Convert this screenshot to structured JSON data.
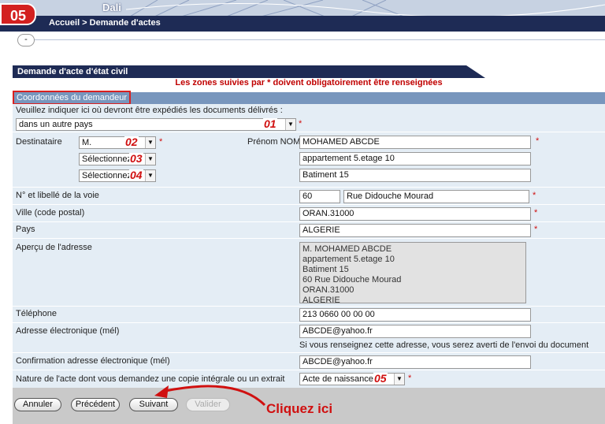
{
  "header": {
    "step_badge": "05",
    "app_title": "Dali",
    "breadcrumb": "Accueil > Demande d'actes",
    "collapse_label": "-"
  },
  "section": {
    "title": "Demande d'acte d'état civil",
    "required_notice": "Les zones suivies par * doivent obligatoirement être renseignées",
    "subsection_title": "Coordonnées du demandeur"
  },
  "form": {
    "shipping_prompt": "Veuillez indiquer ici où devront être expédiés les documents délivrés :",
    "shipping_select": "dans un autre pays",
    "shipping_marker": "01",
    "recipient_label": "Destinataire",
    "civility_select": "M.",
    "civility_marker": "02",
    "select2_value": "Sélectionnez",
    "select2_marker": "03",
    "select3_value": "Sélectionnez",
    "select3_marker": "04",
    "name_label": "Prénom NOM",
    "name_value": "MOHAMED ABCDE",
    "address_line1": "appartement 5.etage 10",
    "address_line2": "Batiment 15",
    "street_label": "N° et libellé de la voie",
    "street_number": "60",
    "street_name": "Rue Didouche Mourad",
    "city_label": "Ville (code postal)",
    "city_value": "ORAN.31000",
    "country_label": "Pays",
    "country_value": "ALGERIE",
    "preview_label": "Aperçu de l'adresse",
    "preview_lines": [
      "M. MOHAMED ABCDE",
      "appartement 5.etage 10",
      "Batiment 15",
      "60 Rue Didouche Mourad",
      "ORAN.31000",
      "ALGERIE"
    ],
    "phone_label": "Téléphone",
    "phone_value": "213 0660 00 00 00",
    "email_label": "Adresse électronique (mél)",
    "email_value": "ABCDE@yahoo.fr",
    "email_note": "Si vous renseignez cette adresse, vous serez averti de l'envoi du document",
    "email_confirm_label": "Confirmation adresse électronique (mél)",
    "email_confirm_value": "ABCDE@yahoo.fr",
    "act_nature_label": "Nature de l'acte dont vous demandez une copie intégrale ou un extrait",
    "act_nature_select": "Acte de naissance",
    "act_nature_marker": "05",
    "required_star": "*"
  },
  "buttons": {
    "cancel": "Annuler",
    "previous": "Précédent",
    "next": "Suivant",
    "validate": "Valider"
  },
  "annotation": {
    "callout_text": "Cliquez ici"
  },
  "colors": {
    "navy": "#1e2b55",
    "form_bg": "#e4edf5",
    "subheader": "#7896bd",
    "alert_red": "#d01010"
  }
}
